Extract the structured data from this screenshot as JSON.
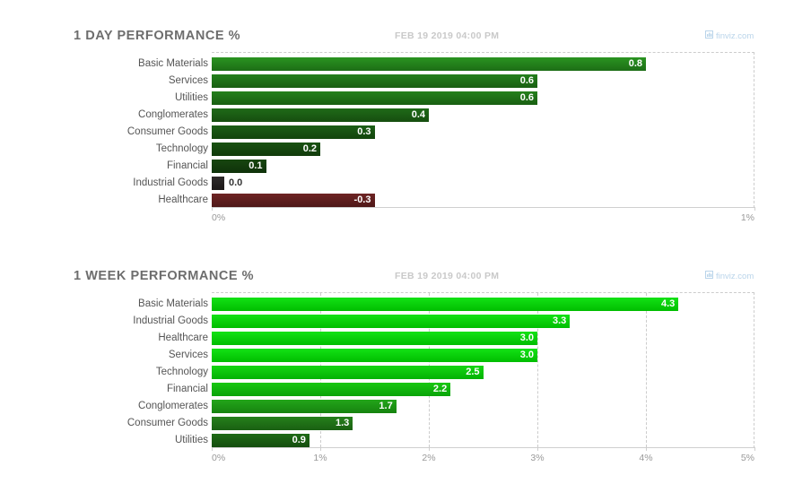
{
  "brand": {
    "name": "finviz.com",
    "icon": "chart-square-icon",
    "color": "#b9d4ea"
  },
  "charts": [
    {
      "id": "one-day",
      "title": "1 DAY PERFORMANCE %",
      "timestamp": "FEB 19 2019 04:00 PM",
      "axis_ticks": [
        "0%",
        "1%"
      ]
    },
    {
      "id": "one-week",
      "title": "1 WEEK PERFORMANCE %",
      "timestamp": "FEB 19 2019 04:00 PM",
      "axis_ticks": [
        "0%",
        "1%",
        "2%",
        "3%",
        "4%",
        "5%"
      ]
    }
  ],
  "chart_data": [
    {
      "type": "bar",
      "orientation": "horizontal",
      "title": "1 DAY PERFORMANCE %",
      "subtitle": "FEB 19 2019 04:00 PM",
      "xlabel": "",
      "ylabel": "",
      "xlim": [
        0,
        1
      ],
      "xticks": [
        0,
        1
      ],
      "xticklabels": [
        "0%",
        "1%"
      ],
      "grid": false,
      "legend": "none",
      "categories": [
        "Basic Materials",
        "Services",
        "Utilities",
        "Conglomerates",
        "Consumer Goods",
        "Technology",
        "Financial",
        "Industrial Goods",
        "Healthcare"
      ],
      "values": [
        0.8,
        0.6,
        0.6,
        0.4,
        0.3,
        0.2,
        0.1,
        0.0,
        -0.3
      ],
      "value_labels": [
        "0.8",
        "0.6",
        "0.6",
        "0.4",
        "0.3",
        "0.2",
        "0.1",
        "0.0",
        "-0.3"
      ],
      "bar_colors": [
        "#2a9421",
        "#24801c",
        "#24801c",
        "#1f6a18",
        "#1c5e16",
        "#195212",
        "#17460f",
        "#2e2a2a",
        "#6e2424"
      ],
      "bar_colors_bottom": [
        "#1d6d16",
        "#195f12",
        "#195f12",
        "#164e0f",
        "#13450d",
        "#113b0b",
        "#0f320a",
        "#1c1818",
        "#4e1818"
      ]
    },
    {
      "type": "bar",
      "orientation": "horizontal",
      "title": "1 WEEK PERFORMANCE %",
      "subtitle": "FEB 19 2019 04:00 PM",
      "xlabel": "",
      "ylabel": "",
      "xlim": [
        0,
        5
      ],
      "xticks": [
        0,
        1,
        2,
        3,
        4,
        5
      ],
      "xticklabels": [
        "0%",
        "1%",
        "2%",
        "3%",
        "4%",
        "5%"
      ],
      "grid": true,
      "legend": "none",
      "categories": [
        "Basic Materials",
        "Industrial Goods",
        "Healthcare",
        "Services",
        "Technology",
        "Financial",
        "Conglomerates",
        "Consumer Goods",
        "Utilities"
      ],
      "values": [
        4.3,
        3.3,
        3.0,
        3.0,
        2.5,
        2.2,
        1.7,
        1.3,
        0.9
      ],
      "value_labels": [
        "4.3",
        "3.3",
        "3.0",
        "3.0",
        "2.5",
        "2.2",
        "1.7",
        "1.3",
        "0.9"
      ],
      "bar_colors": [
        "#13e215",
        "#13e215",
        "#13e215",
        "#13e215",
        "#16d614",
        "#19c712",
        "#23a51a",
        "#257f1b",
        "#1f6b16"
      ],
      "bar_colors_bottom": [
        "#00bd00",
        "#00bd00",
        "#00bd00",
        "#00bd00",
        "#03b103",
        "#0aa309",
        "#16830f",
        "#1a6012",
        "#154d0f"
      ]
    }
  ]
}
